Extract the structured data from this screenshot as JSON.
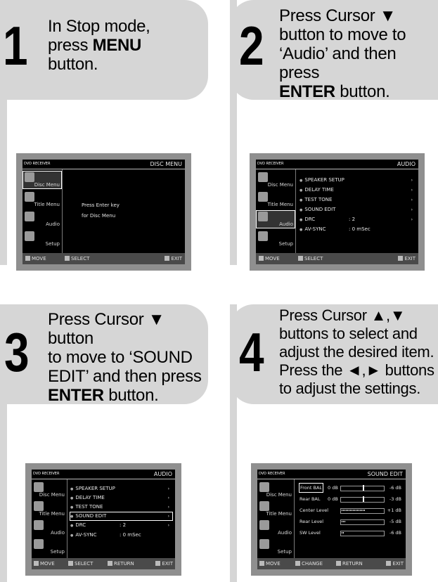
{
  "steps": [
    {
      "number": "1",
      "text_parts": [
        "In Stop mode, ",
        "press ",
        "MENU",
        " button."
      ],
      "screen": {
        "brand": "DVD RECEIVER",
        "title": "DISC MENU",
        "sidebar": [
          "Disc Menu",
          "Title Menu",
          "Audio",
          "Setup"
        ],
        "message_line1": "Press Enter key",
        "message_line2": "for Disc Menu",
        "footer": [
          "MOVE",
          "SELECT",
          "EXIT"
        ]
      }
    },
    {
      "number": "2",
      "text_parts": [
        "Press Cursor ▼ ",
        "button to move to ",
        "‘Audio’ and then press ",
        "ENTER",
        " button."
      ],
      "screen": {
        "brand": "DVD RECEIVER",
        "title": "AUDIO",
        "sidebar": [
          "Disc Menu",
          "Title Menu",
          "Audio",
          "Setup"
        ],
        "items": [
          {
            "label": "SPEAKER SETUP",
            "value": "",
            "arrow": "›"
          },
          {
            "label": "DELAY TIME",
            "value": "",
            "arrow": "›"
          },
          {
            "label": "TEST TONE",
            "value": "",
            "arrow": "›"
          },
          {
            "label": "SOUND EDIT",
            "value": "",
            "arrow": "›"
          },
          {
            "label": "DRC",
            "value": ": 2",
            "arrow": "›"
          },
          {
            "label": "AV-SYNC",
            "value": ": 0 mSec",
            "arrow": ""
          }
        ],
        "footer": [
          "MOVE",
          "SELECT",
          "EXIT"
        ]
      }
    },
    {
      "number": "3",
      "text_parts": [
        "Press Cursor ▼ button ",
        "to move to ‘SOUND ",
        "EDIT’ and then press ",
        "ENTER",
        " button."
      ],
      "screen": {
        "brand": "DVD RECEIVER",
        "title": "AUDIO",
        "sidebar": [
          "Disc Menu",
          "Title Menu",
          "Audio",
          "Setup"
        ],
        "items": [
          {
            "label": "SPEAKER SETUP",
            "value": "",
            "arrow": "›"
          },
          {
            "label": "DELAY TIME",
            "value": "",
            "arrow": "›"
          },
          {
            "label": "TEST TONE",
            "value": "",
            "arrow": "›"
          },
          {
            "label": "SOUND EDIT",
            "value": "",
            "arrow": "›"
          },
          {
            "label": "DRC",
            "value": ": 2",
            "arrow": "›"
          },
          {
            "label": "AV-SYNC",
            "value": ": 0 mSec",
            "arrow": ""
          }
        ],
        "footer": [
          "MOVE",
          "SELECT",
          "RETURN",
          "EXIT"
        ]
      }
    },
    {
      "number": "4",
      "text_parts": [
        "Press Cursor  ▲,▼ ",
        "buttons to select and ",
        "adjust the desired item. ",
        "Press the  ◄,►  buttons ",
        "to adjust the settings."
      ],
      "screen": {
        "brand": "DVD RECEIVER",
        "title": "SOUND EDIT",
        "sidebar": [
          "Disc Menu",
          "Title Menu",
          "Audio",
          "Setup"
        ],
        "rows": [
          {
            "name": "Front BAL",
            "mid": "0 dB",
            "db": "-6 dB",
            "level": 0.5
          },
          {
            "name": "Rear BAL",
            "mid": "0 dB",
            "db": "-3 dB",
            "level": 0.5
          },
          {
            "name": "Center Level",
            "mid": "",
            "db": "+1 dB",
            "level": 0.55
          },
          {
            "name": "Rear Level",
            "mid": "",
            "db": "-5 dB",
            "level": 0.1
          },
          {
            "name": "SW Level",
            "mid": "",
            "db": "-6 dB",
            "level": 0.05
          }
        ],
        "footer": [
          "MOVE",
          "CHANGE",
          "RETURN",
          "EXIT"
        ]
      }
    }
  ]
}
